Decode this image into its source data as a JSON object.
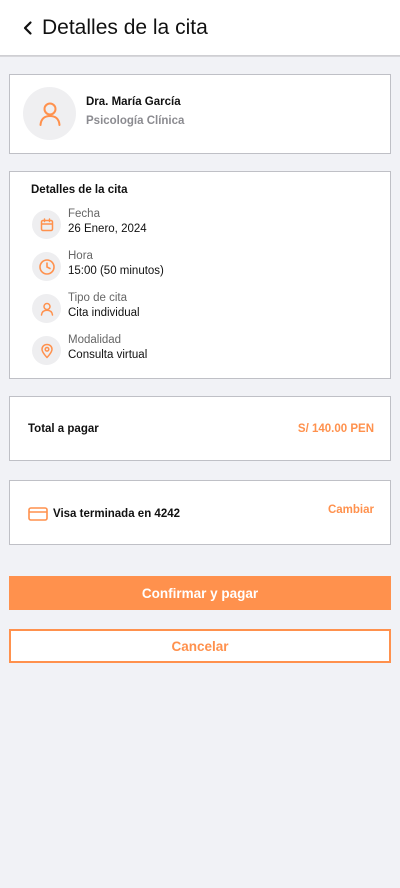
{
  "header": {
    "title": "Detalles de la cita",
    "back_icon": "chevron-left-icon"
  },
  "doctor": {
    "name": "Dra. María García",
    "specialty": "Psicología Clínica",
    "avatar_icon": "user-icon"
  },
  "details": {
    "title": "Detalles de la cita",
    "items": [
      {
        "label": "Fecha",
        "value": "26 Enero, 2024",
        "icon": "calendar-icon"
      },
      {
        "label": "Hora",
        "value": "15:00 (50 minutos)",
        "icon": "clock-icon"
      },
      {
        "label": "Tipo de cita",
        "value": "Cita individual",
        "icon": "user-icon"
      },
      {
        "label": "Modalidad",
        "value": "Consulta virtual",
        "icon": "location-pin-icon"
      }
    ]
  },
  "total": {
    "label": "Total a pagar",
    "amount": "S/ 140.00 PEN"
  },
  "payment": {
    "label": "Visa terminada en 4242",
    "change_label": "Cambiar",
    "icon": "credit-card-icon"
  },
  "actions": {
    "confirm_label": "Confirmar y pagar",
    "cancel_label": "Cancelar"
  },
  "colors": {
    "accent": "#ff914d",
    "background": "#f1f2f6",
    "card": "#ffffff",
    "muted_text": "#8b8b90"
  }
}
